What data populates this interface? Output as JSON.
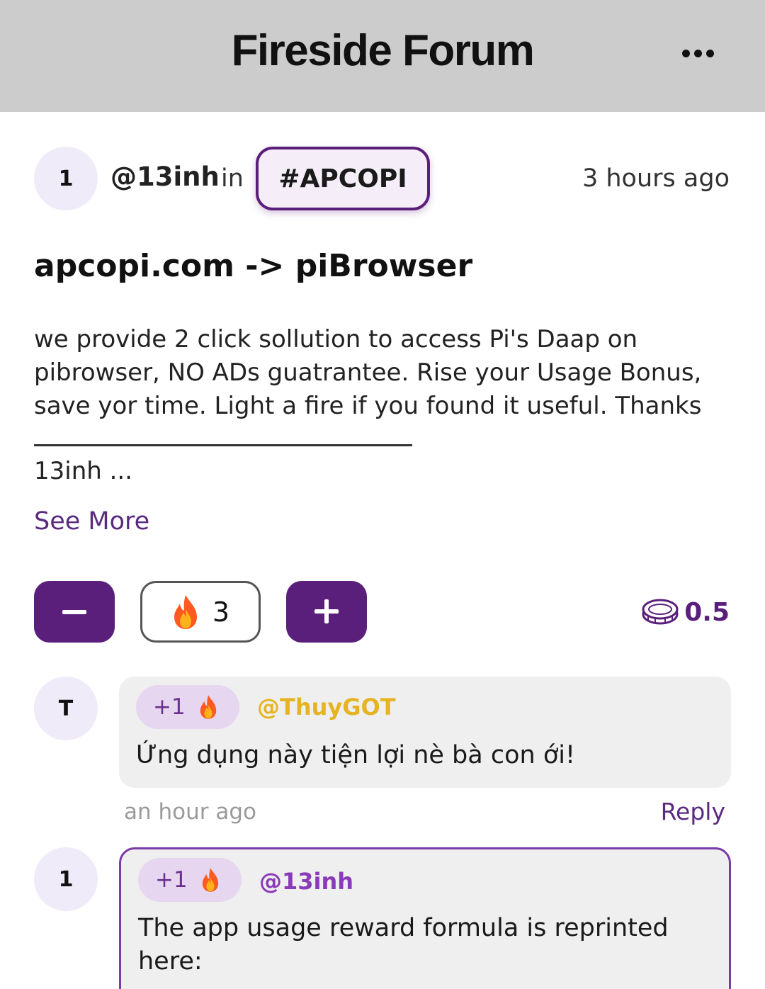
{
  "header": {
    "title": "Fireside Forum",
    "more_icon": "more-horizontal-icon"
  },
  "post": {
    "avatar_initial": "1",
    "author": "@13inh",
    "in_label": "in",
    "tag": "#APCOPI",
    "time": "3 hours ago",
    "title": "apcopi.com -> piBrowser",
    "body_lines": [
      "we provide 2 click sollution to access Pi's Daap  on",
      "pibrowser, NO ADs guatrantee. Rise your Usage Bonus,",
      "save yor time. Light a fire if you found it useful. Thanks"
    ],
    "body_tail": "13inh ...",
    "see_more": "See More",
    "fire_count": "3",
    "coin_value": "0.5",
    "accent_color": "#5a1f7a"
  },
  "comments": [
    {
      "avatar_initial": "T",
      "plus": "+1",
      "author": "@ThuyGOT",
      "author_color": "#e6b422",
      "text": "Ứng dụng này tiện lợi nè bà con ới!",
      "time": "an hour ago",
      "reply": "Reply"
    },
    {
      "avatar_initial": "1",
      "plus": "+1",
      "author": "@13inh",
      "author_color": "#8a3ab8",
      "text_lines": [
        "The app usage reward formula is reprinted",
        "here:"
      ]
    }
  ]
}
